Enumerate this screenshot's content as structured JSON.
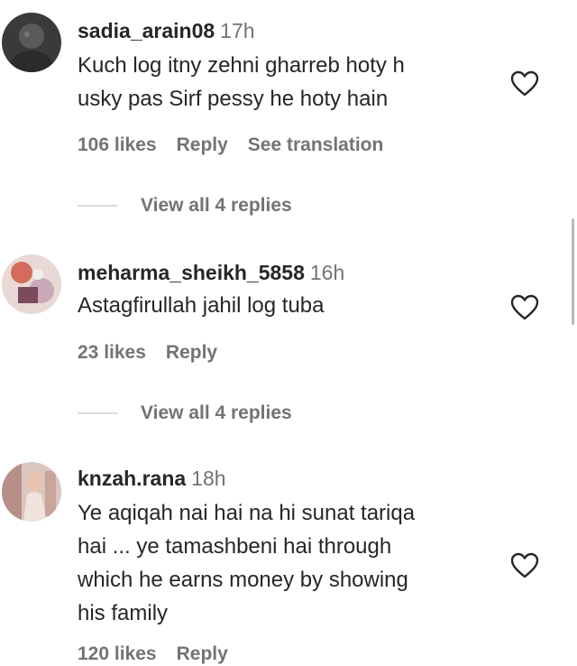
{
  "comments": [
    {
      "username": "sadia_arain08",
      "time": "17h",
      "text_lines": [
        "Kuch log itny zehni gharreb hoty h",
        "usky pas Sirf pessy he hoty hain"
      ],
      "likes": "106 likes",
      "reply": "Reply",
      "translate": "See translation",
      "view_replies": "View all 4 replies"
    },
    {
      "username": "meharma_sheikh_5858",
      "time": "16h",
      "text_lines": [
        "Astagfirullah jahil log tuba"
      ],
      "likes": "23 likes",
      "reply": "Reply",
      "view_replies": "View all 4 replies"
    },
    {
      "username": "knzah.rana",
      "time": "18h",
      "text_lines": [
        "Ye aqiqah nai hai na hi sunat tariqa",
        "hai ... ye tamashbeni hai through",
        "which he earns money by showing",
        "his family"
      ],
      "likes": "120 likes",
      "reply": "Reply"
    }
  ],
  "icons": {
    "like": "heart-outline-icon"
  },
  "colors": {
    "username": "#262626",
    "secondary_text": "#737373",
    "divider": "#dbdbdb"
  }
}
